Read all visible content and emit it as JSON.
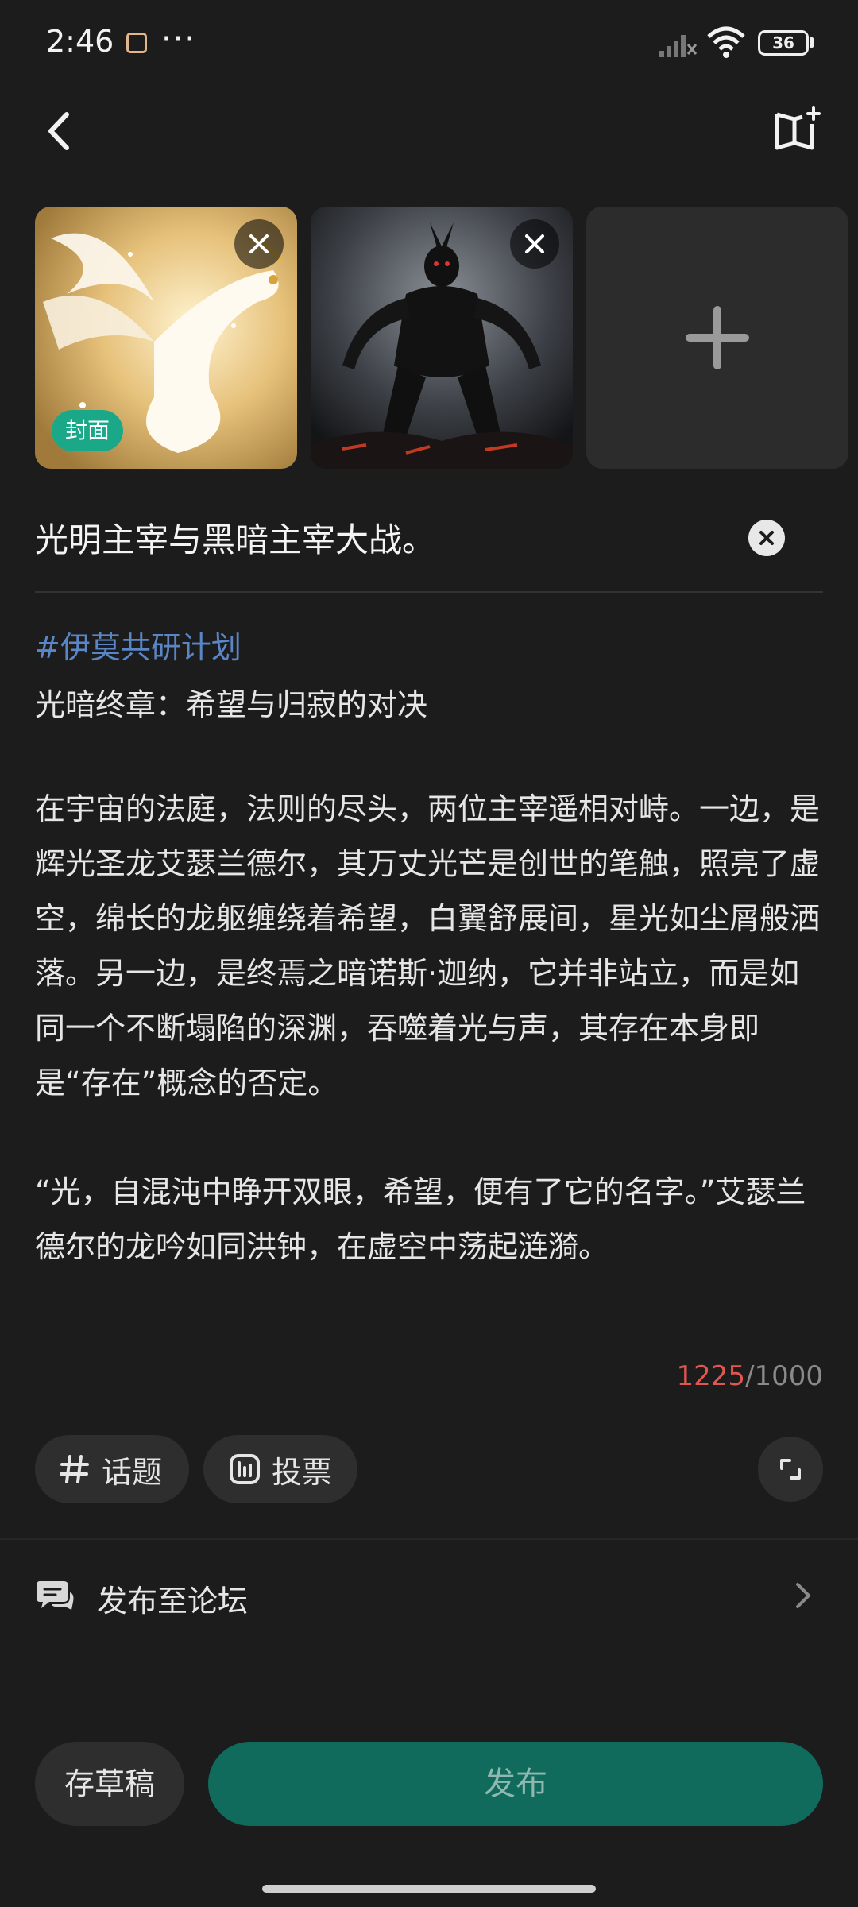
{
  "status_bar": {
    "time": "2:46",
    "dots": "···",
    "battery": "36",
    "icons": [
      "app-badge-icon",
      "signal-icon",
      "wifi-icon",
      "battery-icon"
    ]
  },
  "header": {
    "back_icon": "back-arrow-icon",
    "ebook_icon": "book-add-icon"
  },
  "images": {
    "cover_label": "封面",
    "items": [
      {
        "name": "light-dragon-image"
      },
      {
        "name": "dark-demon-image"
      }
    ],
    "add_icon": "plus-icon"
  },
  "post": {
    "title": "光明主宰与黑暗主宰大战。",
    "topic": "#伊莫共研计划",
    "subtitle": "光暗终章：希望与归寂的对决",
    "paragraph1": "在宇宙的法庭，法则的尽头，两位主宰遥相对峙。一边，是辉光圣龙艾瑟兰德尔，其万丈光芒是创世的笔触，照亮了虚空，绵长的龙躯缠绕着希望，白翼舒展间，星光如尘屑般洒落。另一边，是终焉之暗诺斯·迦纳，它并非站立，而是如同一个不断塌陷的深渊，吞噬着光与声，其存在本身即是“存在”概念的否定。",
    "paragraph2": "“光，自混沌中睁开双眼，希望，便有了它的名字。”艾瑟兰德尔的龙吟如同洪钟，在虚空中荡起涟漪。",
    "char_count": "1225",
    "char_limit": "/1000"
  },
  "tools": {
    "topic_label": "话题",
    "vote_label": "投票"
  },
  "forum": {
    "label": "发布至论坛"
  },
  "actions": {
    "draft_label": "存草稿",
    "publish_label": "发布"
  },
  "colors": {
    "background": "#1c1c1c",
    "accent_green": "#106b5c",
    "cover_tag": "#1aa888",
    "topic_blue": "#5a86c6",
    "over_limit_red": "#e0574f"
  }
}
